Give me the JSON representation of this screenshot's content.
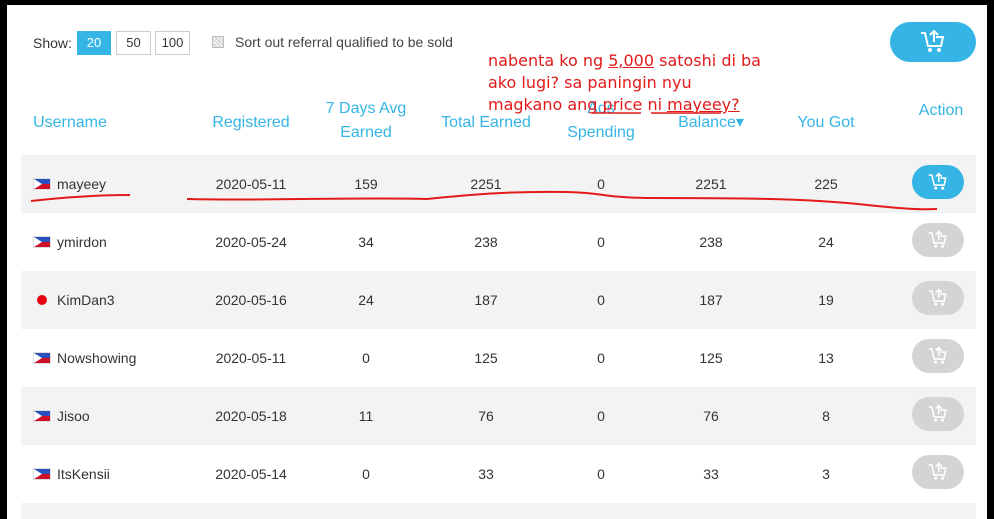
{
  "toolbar": {
    "show_label": "Show:",
    "page_sizes": [
      "20",
      "50",
      "100"
    ],
    "active_page_size": "20",
    "sort_label": "Sort out referral qualified to be sold",
    "cart_icon": "cart-upload-icon"
  },
  "table": {
    "headers": {
      "username": "Username",
      "registered": "Registered",
      "avg_line1": "7 Days Avg",
      "avg_line2": "Earned",
      "total": "Total Earned",
      "ads_line1": "Ads",
      "ads_line2": "Spending",
      "balance": "Balance",
      "you_got": "You Got",
      "action": "Action"
    },
    "sort_indicator": "▾",
    "rows": [
      {
        "username": "mayeey",
        "flag": "PH",
        "registered": "2020-05-11",
        "avg": "159",
        "total": "2251",
        "ads": "0",
        "balance": "2251",
        "you_got": "225"
      },
      {
        "username": "ymirdon",
        "flag": "PH",
        "registered": "2020-05-24",
        "avg": "34",
        "total": "238",
        "ads": "0",
        "balance": "238",
        "you_got": "24"
      },
      {
        "username": "KimDan3",
        "flag": "JP",
        "registered": "2020-05-16",
        "avg": "24",
        "total": "187",
        "ads": "0",
        "balance": "187",
        "you_got": "19"
      },
      {
        "username": "Nowshowing",
        "flag": "PH",
        "registered": "2020-05-11",
        "avg": "0",
        "total": "125",
        "ads": "0",
        "balance": "125",
        "you_got": "13"
      },
      {
        "username": "Jisoo",
        "flag": "PH",
        "registered": "2020-05-18",
        "avg": "11",
        "total": "76",
        "ads": "0",
        "balance": "76",
        "you_got": "8"
      },
      {
        "username": "ItsKensii",
        "flag": "PH",
        "registered": "2020-05-14",
        "avg": "0",
        "total": "33",
        "ads": "0",
        "balance": "33",
        "you_got": "3"
      }
    ]
  },
  "annotation": {
    "line1_a": "nabenta ko ng ",
    "line1_b": "5,000",
    "line1_c": " satoshi di ba",
    "line2": "ako lugi? sa paningin nyu",
    "line3_a": "magkano ang price ni ",
    "line3_b": "mayeey?"
  },
  "colors": {
    "accent": "#34b5e5",
    "annotation": "#e21a1a",
    "row_alt": "#f3f3f3",
    "disabled": "#d4d4d4"
  }
}
